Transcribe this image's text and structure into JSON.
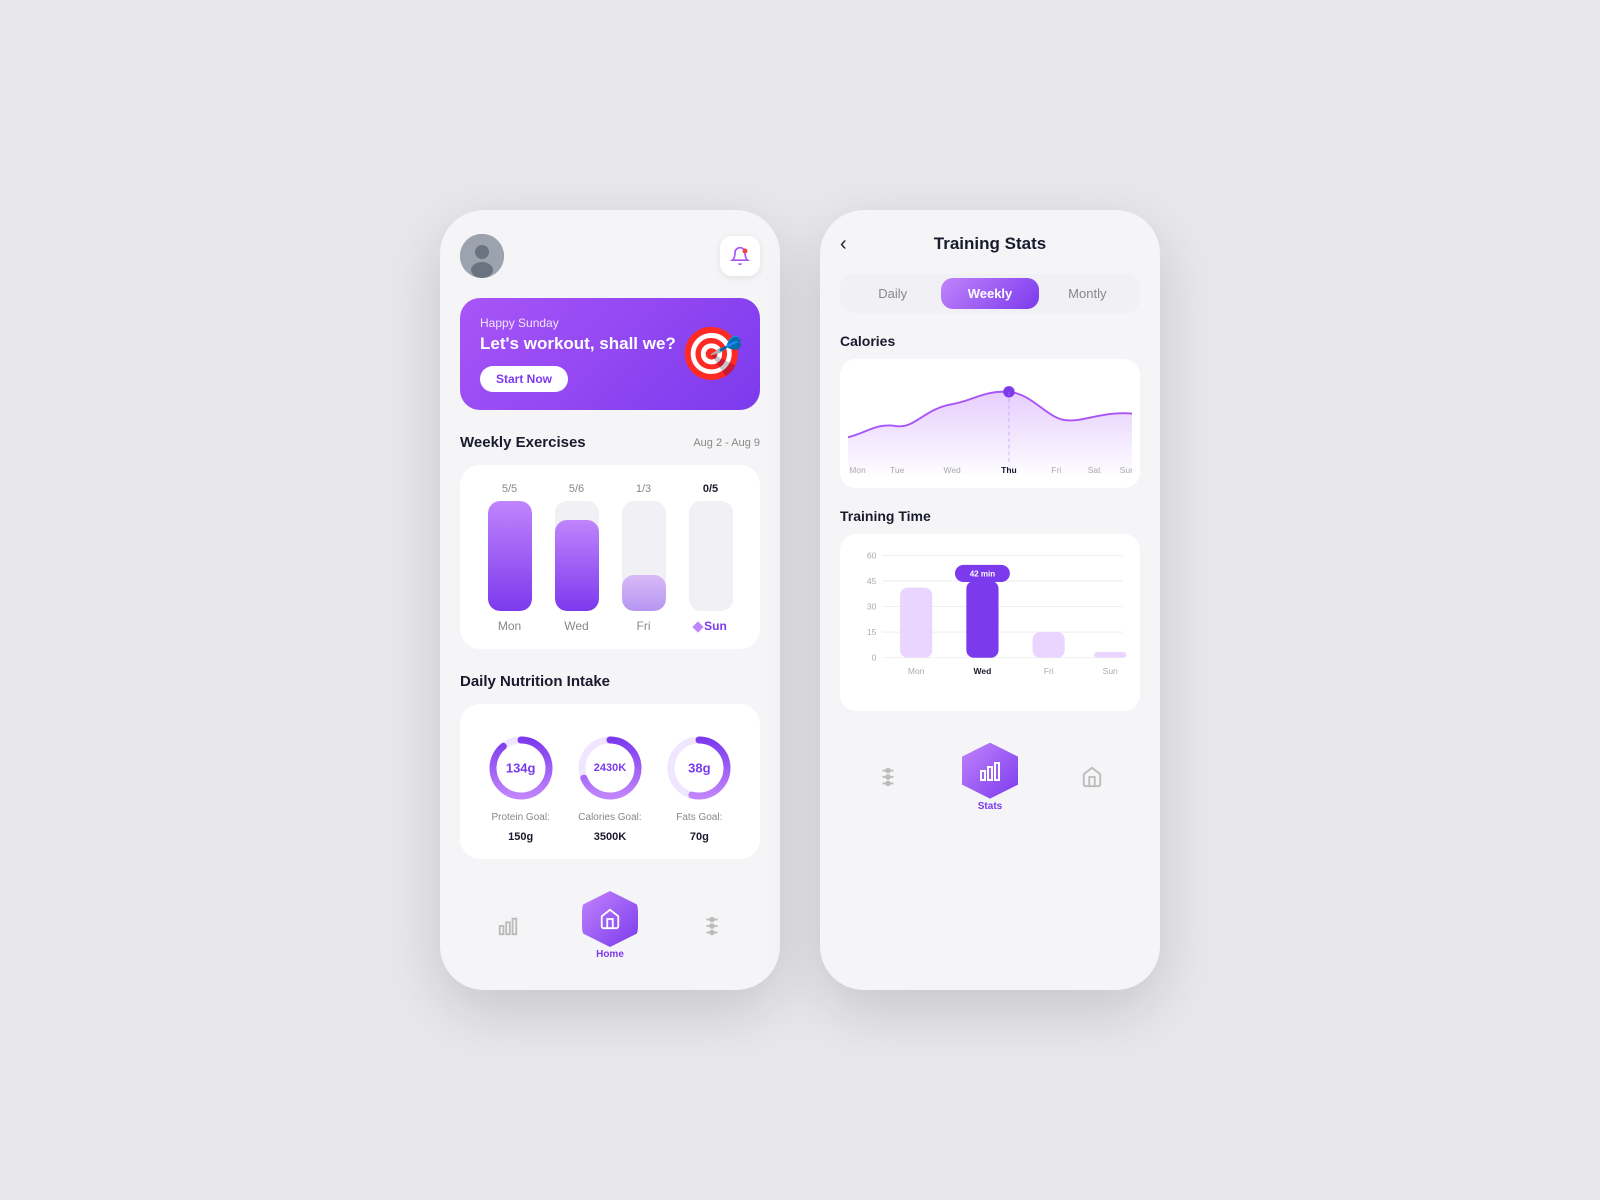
{
  "left_phone": {
    "greeting": "Happy Sunday",
    "subtitle": "Let's workout, shall we?",
    "start_btn": "Start Now",
    "weekly_title": "Weekly Exercises",
    "date_range": "Aug 2 - Aug 9",
    "bars": [
      {
        "label_top": "5/5",
        "day": "Mon",
        "fill_pct": 95,
        "type": "full",
        "active": false
      },
      {
        "label_top": "5/6",
        "day": "Wed",
        "fill_pct": 80,
        "type": "partial",
        "active": false
      },
      {
        "label_top": "1/3",
        "day": "Fri",
        "fill_pct": 25,
        "type": "partial",
        "active": false
      },
      {
        "label_top": "0/5",
        "day": "Sun",
        "fill_pct": 0,
        "type": "empty",
        "active": true
      }
    ],
    "nutrition_title": "Daily Nutrition Intake",
    "nutrition_items": [
      {
        "value": "134g",
        "goal_label": "Protein Goal:",
        "goal_value": "150g",
        "percent": 89
      },
      {
        "value": "2430K",
        "goal_label": "Calories Goal:",
        "goal_value": "3500K",
        "percent": 69
      },
      {
        "value": "38g",
        "goal_label": "Fats Goal:",
        "goal_value": "70g",
        "percent": 54
      }
    ],
    "bottom_nav": [
      {
        "icon": "bar-chart",
        "label": "Stats",
        "active": false
      },
      {
        "icon": "home",
        "label": "Home",
        "active": true
      },
      {
        "icon": "settings",
        "label": "",
        "active": false
      }
    ]
  },
  "right_phone": {
    "back_label": "‹",
    "title": "Training Stats",
    "tabs": [
      {
        "label": "Daily",
        "active": false
      },
      {
        "label": "Weekly",
        "active": true
      },
      {
        "label": "Montly",
        "active": false
      }
    ],
    "calories_label": "Calories",
    "calories_x_labels": [
      "Mon",
      "Tue",
      "Wed",
      "Thu",
      "Fri",
      "Sat",
      "Sun"
    ],
    "calories_active_day": "Thu",
    "training_label": "Training Time",
    "training_y_labels": [
      "60",
      "45",
      "30",
      "15",
      "0"
    ],
    "training_x_labels": [
      "Mon",
      "Wed",
      "Fri",
      "Sun"
    ],
    "training_active_bar": "Wed",
    "training_active_value": "42 min",
    "bottom_nav": [
      {
        "icon": "settings",
        "label": "",
        "active": false
      },
      {
        "icon": "bar-chart",
        "label": "Stats",
        "active": true
      },
      {
        "icon": "home",
        "label": "",
        "active": false
      }
    ]
  }
}
